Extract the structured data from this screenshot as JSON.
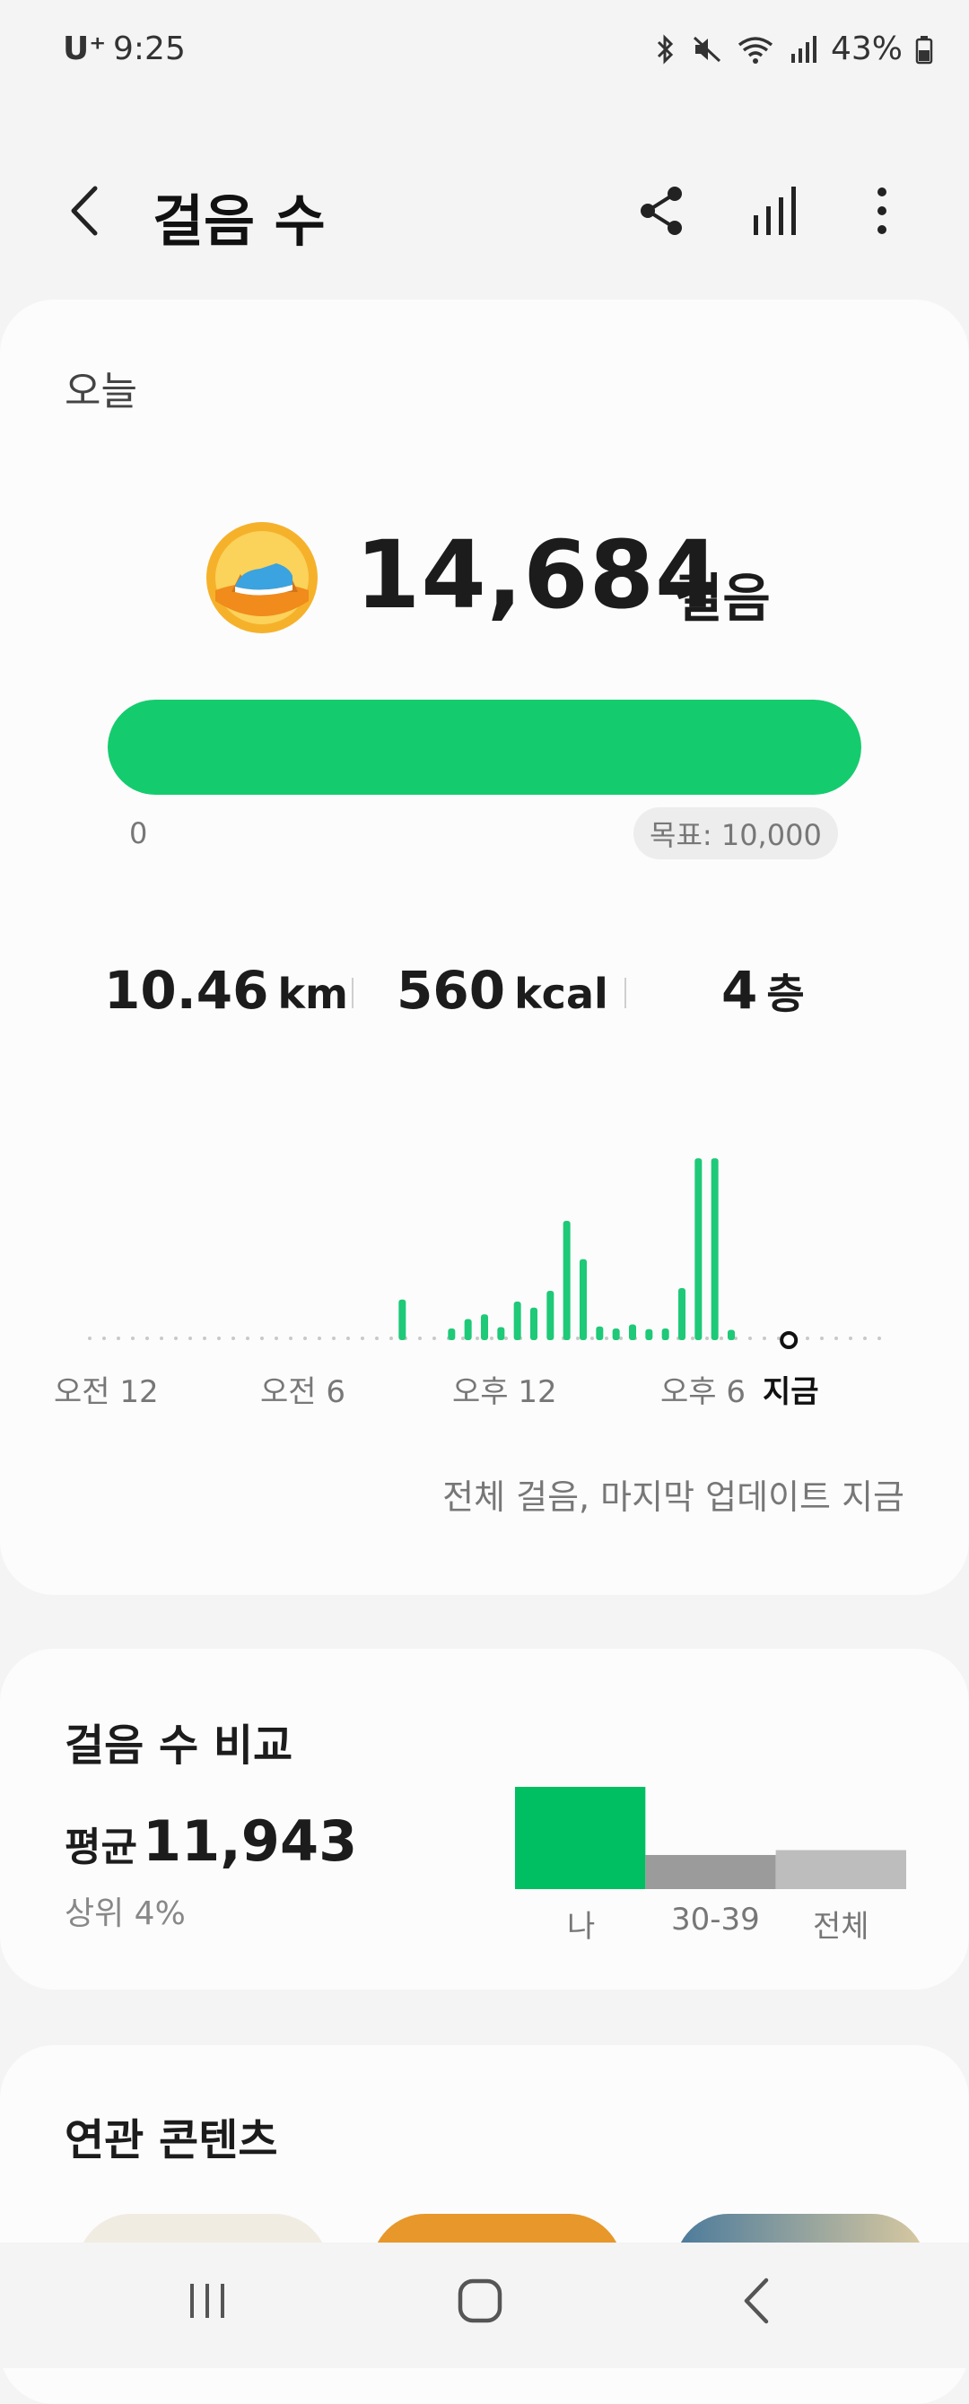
{
  "status": {
    "carrier": "U⁺",
    "time": "9:25",
    "battery": "43%"
  },
  "header": {
    "title": "걸음 수",
    "icons": [
      "back-icon",
      "share-icon",
      "chart-icon",
      "more-icon"
    ]
  },
  "today": {
    "label": "오늘",
    "steps": "14,684",
    "unit": "걸음",
    "progress_fraction": 1.0,
    "bar_min": "0",
    "goal": "목표: 10,000",
    "distance_value": "10.46",
    "distance_unit": "km",
    "kcal_value": "560",
    "kcal_unit": "kcal",
    "floors_value": "4",
    "floors_unit": "층",
    "updated": "전체 걸음, 마지막 업데이트 지금"
  },
  "chart_data": {
    "type": "bar",
    "xlabel": "",
    "ylabel": "",
    "tick_labels": [
      "오전 12",
      "오전 6",
      "오후 12",
      "오후 6",
      "지금"
    ],
    "x_range_hours": [
      0,
      24
    ],
    "now_hour": 21.25,
    "bar_hours": [
      9.5,
      11,
      11.5,
      12,
      12.5,
      13,
      13.5,
      14,
      14.5,
      15,
      15.5,
      16,
      16.5,
      17,
      17.5,
      18,
      18.5,
      19,
      19.5,
      20,
      20.5
    ],
    "values": [
      550,
      120,
      260,
      330,
      140,
      520,
      430,
      680,
      1720,
      1150,
      150,
      120,
      180,
      110,
      120,
      720,
      2650,
      2650,
      100,
      0,
      0
    ],
    "ylim": [
      0,
      2800
    ],
    "bar_color": "#1ec978"
  },
  "compare": {
    "title": "걸음 수 비교",
    "avg_label": "평균",
    "avg_value": "11,943",
    "rank": "상위 4%",
    "chart_data": {
      "type": "bar",
      "categories": [
        "나",
        "30-39",
        "전체"
      ],
      "values": [
        14684,
        4900,
        5600
      ],
      "colors": [
        "#00bf63",
        "#9b9b9b",
        "#bdbdbd"
      ]
    }
  },
  "related": {
    "title": "연관 콘텐츠"
  },
  "navbar": {
    "icons": [
      "recent-apps-icon",
      "home-icon",
      "nav-back-icon"
    ]
  }
}
